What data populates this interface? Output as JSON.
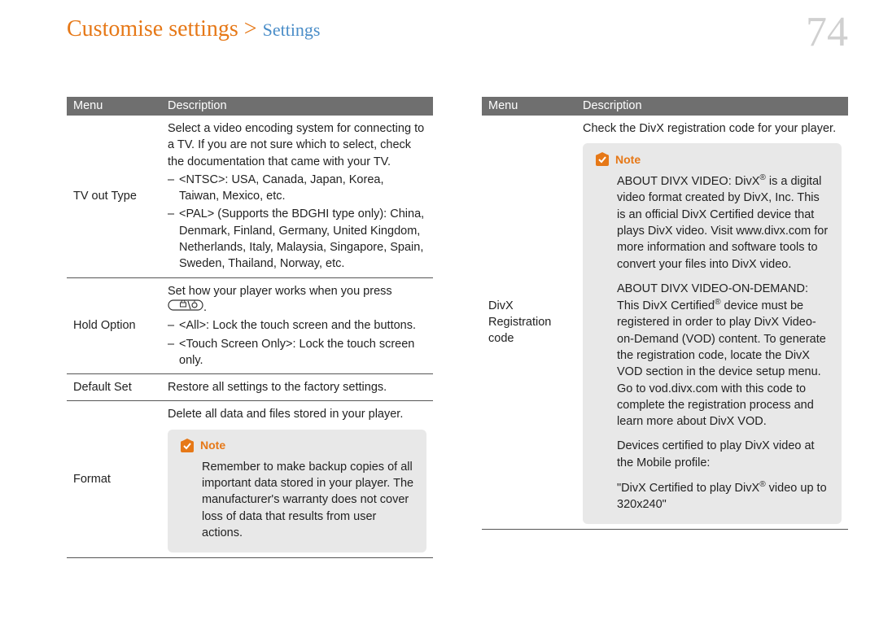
{
  "header": {
    "main": "Customise settings",
    "separator": " > ",
    "sub": "Settings"
  },
  "page_number": "74",
  "table_headers": {
    "menu": "Menu",
    "description": "Description"
  },
  "left_rows": {
    "tvout": {
      "menu": "TV out Type",
      "intro": "Select a video encoding system for connecting to a TV. If you are not sure which to select, check the documentation that came with your TV.",
      "b1": "<NTSC>: USA, Canada, Japan, Korea, Taiwan, Mexico, etc.",
      "b2": "<PAL> (Supports the BDGHI type only): China, Denmark, Finland, Germany, United Kingdom, Netherlands, Italy, Malaysia, Singapore, Spain, Sweden, Thailand, Norway, etc."
    },
    "hold": {
      "menu": "Hold Option",
      "intro_a": "Set how your player works when you press ",
      "intro_b": ".",
      "b1": "<All>: Lock the touch screen and the buttons.",
      "b2": "<Touch Screen Only>: Lock the touch screen only."
    },
    "default": {
      "menu": "Default Set",
      "desc": "Restore all settings to the factory settings."
    },
    "format": {
      "menu": "Format",
      "intro": "Delete all data and files stored in your player.",
      "note_label": "Note",
      "note_body": "Remember to make backup copies of all important data stored in your player. The manufacturer's warranty does not cover loss of data that results from user actions."
    }
  },
  "right_rows": {
    "divx": {
      "menu": "DivX Registration code",
      "intro": "Check the DivX registration code for your player.",
      "note_label": "Note",
      "p1a": "ABOUT DIVX VIDEO: DivX",
      "p1b": " is a digital video format created by DivX, Inc. This is an official DivX Certified device that plays DivX video. Visit www.divx.com for more information and software tools to convert your files into DivX video.",
      "p2a": "ABOUT DIVX VIDEO-ON-DEMAND: This DivX Certified",
      "p2b": " device must be registered in order to play DivX Video-on-Demand (VOD) content. To generate the registration code, locate the DivX VOD section in the device setup menu. Go to vod.divx.com with this code to complete the registration process and learn more about DivX VOD.",
      "p3": "Devices certified to play DivX video at the Mobile profile:",
      "p4a": "\"DivX Certified to play DivX",
      "p4b": " video up to 320x240\""
    }
  },
  "reg_mark": "®"
}
